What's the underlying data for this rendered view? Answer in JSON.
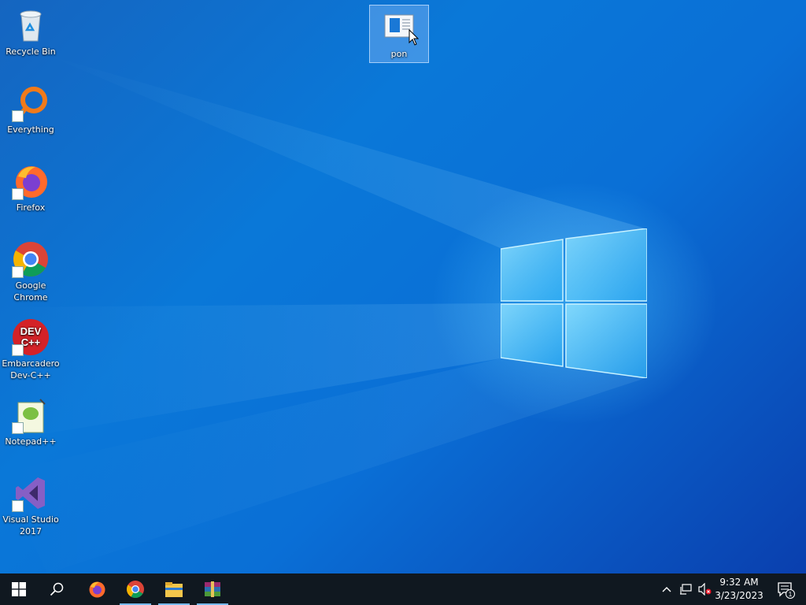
{
  "desktop": {
    "icons": [
      {
        "label": "Recycle Bin"
      },
      {
        "label": "Everything"
      },
      {
        "label": "Firefox"
      },
      {
        "label": "Google Chrome"
      },
      {
        "label": "Embarcadero Dev-C++"
      },
      {
        "label": "Notepad++"
      },
      {
        "label": "Visual Studio 2017"
      },
      {
        "label": "pon"
      }
    ],
    "devcpp_badge": {
      "line1": "DEV",
      "line2": "C++"
    }
  },
  "taskbar": {
    "clock": {
      "time": "9:32 AM",
      "date": "3/23/2023"
    },
    "notifications_count": "1",
    "pinned": [
      {
        "name": "firefox-icon"
      },
      {
        "name": "chrome-icon"
      },
      {
        "name": "file-explorer-icon"
      },
      {
        "name": "winrar-icon"
      }
    ]
  },
  "colors": {
    "desktop_blue": "#0a78d8",
    "taskbar_bg": "#101820",
    "running_indicator": "#76b9ed"
  }
}
